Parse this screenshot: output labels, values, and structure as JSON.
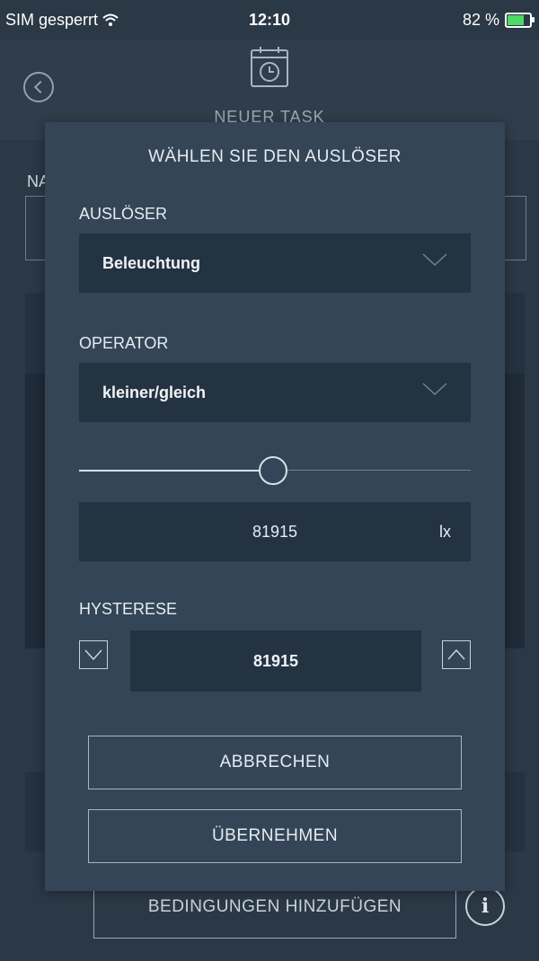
{
  "status_bar": {
    "carrier": "SIM gesperrt",
    "time": "12:10",
    "battery": "82 %"
  },
  "app_bar": {
    "title": "NEUER TASK"
  },
  "background": {
    "name_label_fragment": "NA",
    "add_conditions_label": "BEDINGUNGEN HINZUFÜGEN",
    "info_icon": "info-icon"
  },
  "dialog": {
    "title": "WÄHLEN SIE DEN AUSLÖSER",
    "trigger": {
      "label": "AUSLÖSER",
      "value": "Beleuchtung"
    },
    "operator": {
      "label": "OPERATOR",
      "value": "kleiner/gleich"
    },
    "slider_level": 0.49,
    "value": "81915",
    "unit": "lx",
    "hysteresis": {
      "label": "HYSTERESE",
      "value": "81915"
    },
    "cancel_label": "ABBRECHEN",
    "apply_label": "ÜBERNEHMEN"
  }
}
